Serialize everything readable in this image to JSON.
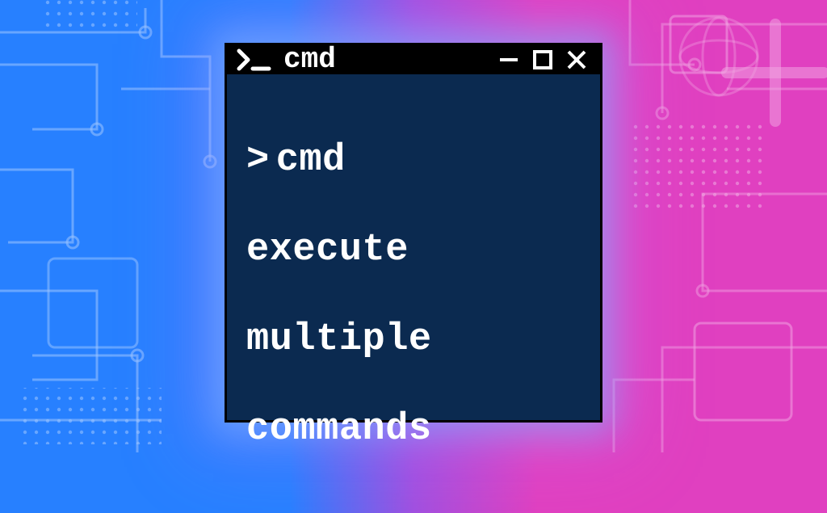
{
  "window": {
    "title": "cmd",
    "prompt_icon": "terminal-prompt-icon"
  },
  "terminal": {
    "prompt": ">",
    "line1": "cmd",
    "line2": "execute",
    "line3": "multiple",
    "line4": "commands"
  },
  "colors": {
    "terminal_bg": "#0b2a50",
    "titlebar_bg": "#000000",
    "text": "#ffffff",
    "bg_left": "#2780ff",
    "bg_right": "#e040c0"
  }
}
